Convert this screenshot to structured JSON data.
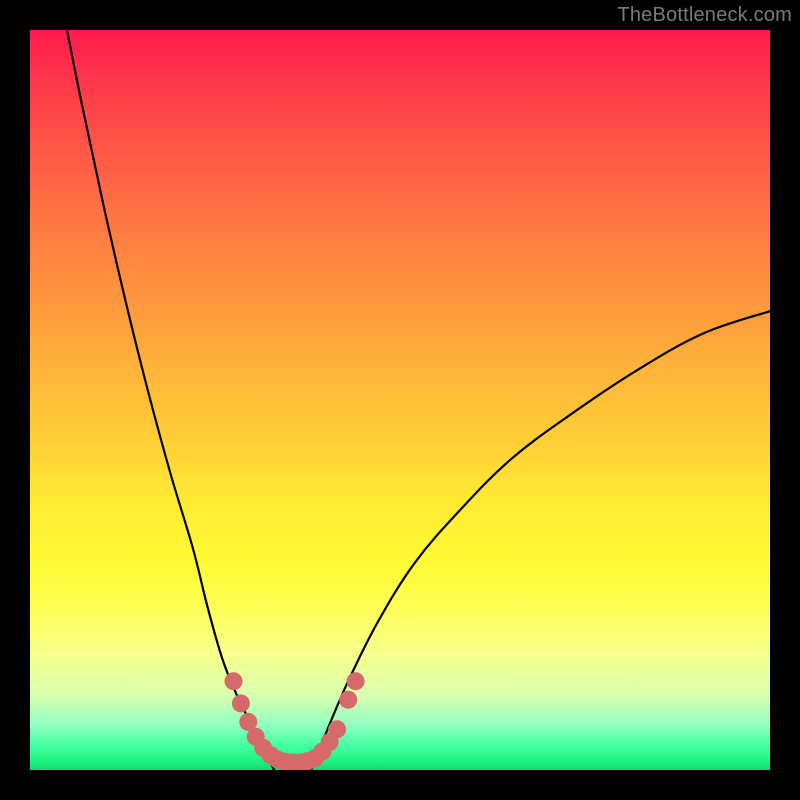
{
  "watermark": "TheBottleneck.com",
  "chart_data": {
    "type": "line",
    "title": "",
    "xlabel": "",
    "ylabel": "",
    "xlim": [
      0,
      100
    ],
    "ylim": [
      0,
      100
    ],
    "grid": false,
    "legend": false,
    "background_gradient": {
      "top": "#ff1a4d",
      "middle": "#ffe833",
      "bottom": "#15d874"
    },
    "series": [
      {
        "name": "left-curve",
        "color": "#000000",
        "x": [
          5,
          7,
          10,
          13,
          16,
          19,
          22,
          24,
          26,
          28,
          30,
          31,
          32,
          33
        ],
        "y": [
          100,
          90,
          76,
          63,
          51,
          40,
          30,
          22,
          15,
          10,
          6,
          4,
          2,
          0
        ]
      },
      {
        "name": "right-curve",
        "color": "#000000",
        "x": [
          38,
          40,
          43,
          47,
          52,
          58,
          65,
          73,
          82,
          91,
          100
        ],
        "y": [
          0,
          5,
          12,
          20,
          28,
          35,
          42,
          48,
          54,
          59,
          62
        ]
      },
      {
        "name": "highlight-dots",
        "color": "#d66a6a",
        "x": [
          27.5,
          28.5,
          29.5,
          30.5,
          31.5,
          32.5,
          33.5,
          34.5,
          35.5,
          36.5,
          37.5,
          38.5,
          39.5,
          40.5,
          41.5,
          43.0,
          44.0
        ],
        "y": [
          12,
          9,
          6.5,
          4.5,
          3,
          2,
          1.4,
          1.1,
          1.0,
          1.0,
          1.2,
          1.6,
          2.5,
          3.8,
          5.5,
          9.5,
          12
        ]
      }
    ]
  }
}
